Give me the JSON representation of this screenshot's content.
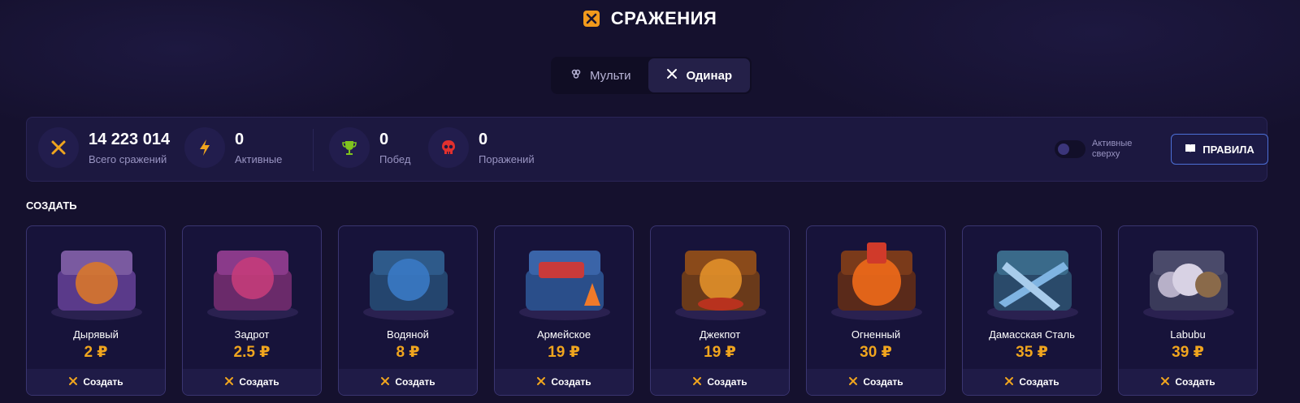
{
  "header": {
    "title": "СРАЖЕНИЯ",
    "icon": "crossed-swords-icon"
  },
  "tabs": [
    {
      "label": "Мульти",
      "icon": "multi-icon",
      "active": false
    },
    {
      "label": "Одинар",
      "icon": "crossed-swords-icon",
      "active": true
    }
  ],
  "stats": {
    "total": {
      "value": "14 223 014",
      "label": "Всего сражений",
      "icon": "crossed-swords-icon"
    },
    "active": {
      "value": "0",
      "label": "Активные",
      "icon": "lightning-icon"
    },
    "wins": {
      "value": "0",
      "label": "Побед",
      "icon": "trophy-icon"
    },
    "losses": {
      "value": "0",
      "label": "Поражений",
      "icon": "skull-icon"
    }
  },
  "toggle": {
    "label": "Активные сверху",
    "on": false
  },
  "rules_button": {
    "label": "ПРАВИЛА",
    "icon": "book-icon"
  },
  "section_title": "СОЗДАТЬ",
  "create_label": "Создать",
  "cases": [
    {
      "name": "Дырявый",
      "price": "2 ₽",
      "accent": "#d8772a"
    },
    {
      "name": "Задрот",
      "price": "2.5 ₽",
      "accent": "#c43c7a"
    },
    {
      "name": "Водяной",
      "price": "8 ₽",
      "accent": "#3a79c4"
    },
    {
      "name": "Армейское",
      "price": "19 ₽",
      "accent": "#c83a3a"
    },
    {
      "name": "Джекпот",
      "price": "19 ₽",
      "accent": "#e1902a"
    },
    {
      "name": "Огненный",
      "price": "30 ₽",
      "accent": "#f06a1a"
    },
    {
      "name": "Дамасская Сталь",
      "price": "35 ₽",
      "accent": "#7fb4e2"
    },
    {
      "name": "Labubu",
      "price": "39 ₽",
      "accent": "#b7b0c8"
    }
  ],
  "colors": {
    "background": "#15112e",
    "accent_orange": "#f0a51e",
    "rules_border": "#4c6fd6"
  }
}
